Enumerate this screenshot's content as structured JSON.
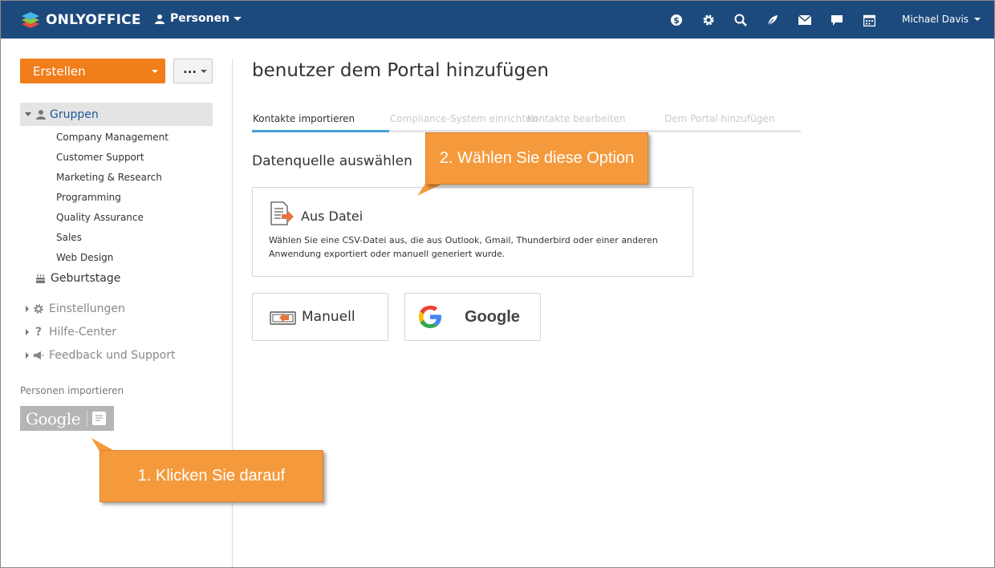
{
  "topbar": {
    "brand": "ONLYOFFICE",
    "module": "Personen",
    "user": "Michael Davis",
    "icons": [
      "payments-icon",
      "settings-gear-icon",
      "search-icon",
      "feed-icon",
      "mail-icon",
      "chat-icon",
      "calendar-icon"
    ]
  },
  "sidebar": {
    "create_label": "Erstellen",
    "more_label": "...",
    "groups_label": "Gruppen",
    "groups": [
      "Company Management",
      "Customer Support",
      "Marketing & Research",
      "Programming",
      "Quality Assurance",
      "Sales",
      "Web Design"
    ],
    "birthdays_label": "Geburtstage",
    "settings_label": "Einstellungen",
    "help_label": "Hilfe-Center",
    "feedback_label": "Feedback und Support",
    "import_label": "Personen importieren",
    "google_label": "Google"
  },
  "main": {
    "title": "benutzer dem Portal hinzufügen",
    "steps": [
      "Kontakte importieren",
      "Compliance-System einrichten",
      "Kontakte bearbeiten",
      "Dem Portal hinzufügen"
    ],
    "source_title": "Datenquelle auswählen",
    "file_option": {
      "title": "Aus Datei",
      "description": "Wählen Sie eine CSV-Datei aus, die aus Outlook, Gmail, Thunderbird oder einer anderen Anwendung exportiert oder manuell generiert wurde."
    },
    "manual_label": "Manuell",
    "google_label": "Google"
  },
  "callouts": {
    "step1": "1. Klicken Sie darauf",
    "step2": "2. Wählen Sie diese Option"
  },
  "colors": {
    "topbar": "#1d4a7c",
    "create_button": "#f07e1a",
    "active_step": "#4aa1da",
    "callout": "#f59a3c",
    "link": "#1f5699"
  }
}
